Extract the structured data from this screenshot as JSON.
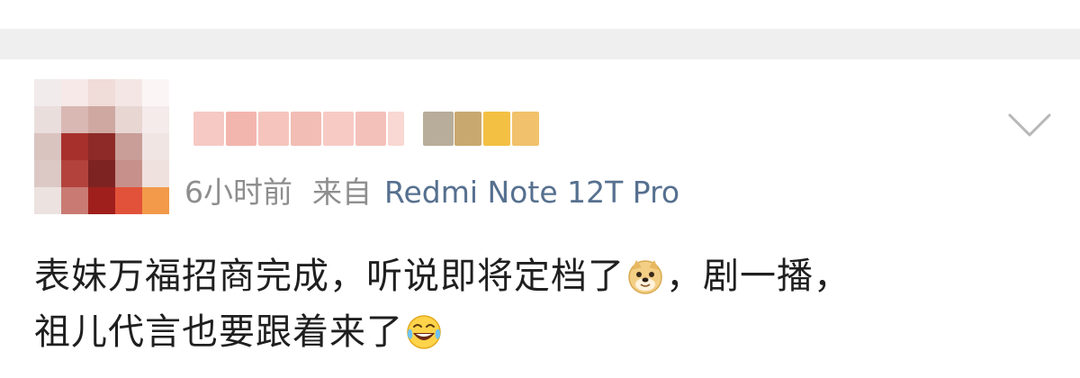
{
  "post": {
    "timestamp": "6小时前",
    "source_prefix": "来自",
    "device": "Redmi Note 12T Pro",
    "line1": "表妹万福招商完成，听说即将定档了",
    "line1_after_emoji": "，剧一播，",
    "line2": "祖儿代言也要跟着来了"
  },
  "icons": {
    "emoji1": "doge-emoji",
    "emoji2": "laugh-cry-emoji",
    "menu": "chevron-down-icon"
  },
  "colors": {
    "device_link": "#56708f",
    "meta_text": "#8e8e8e",
    "body_text": "#1f1f1f",
    "divider_band": "#efefef"
  }
}
